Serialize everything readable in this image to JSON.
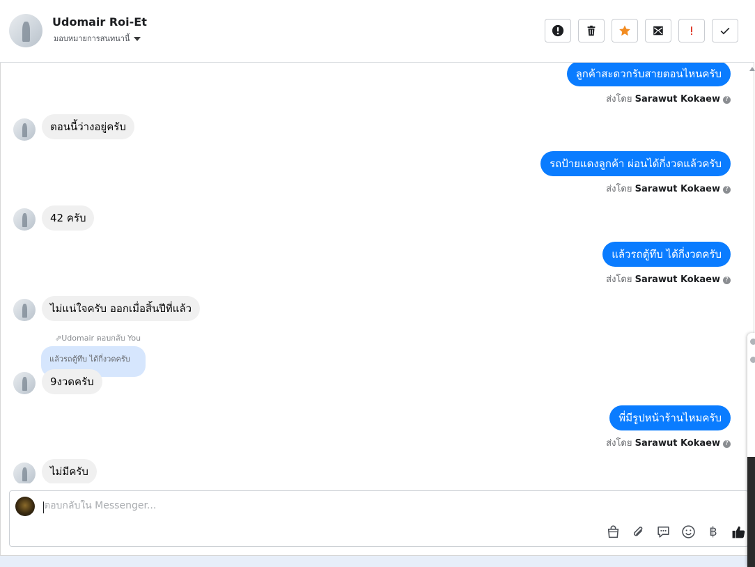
{
  "header": {
    "contact_name": "Udomair Roi-Et",
    "assignment_label": "มอบหมายการสนทนานี้",
    "actions": [
      {
        "name": "report-spam-icon",
        "color": "#1c1e21"
      },
      {
        "name": "trash-icon",
        "color": "#1c1e21"
      },
      {
        "name": "star-icon",
        "color": "#f28b20"
      },
      {
        "name": "mark-unread-icon",
        "color": "#1c1e21"
      },
      {
        "name": "exclamation-icon",
        "color": "#e03c2c"
      },
      {
        "name": "check-icon",
        "color": "#1c1e21"
      }
    ]
  },
  "messages": {
    "m1": {
      "text": "ลูกค้าสะดวกรับสายตอนไหนครับ",
      "sent_by_prefix": "ส่งโดย",
      "sender": "Sarawut Kokaew"
    },
    "m2": {
      "text": "ตอนนี้ว่างอยู่ครับ"
    },
    "m3": {
      "text": "รถป้ายแดงลูกค้า ผ่อนได้กี่งวดแล้วครับ",
      "sent_by_prefix": "ส่งโดย",
      "sender": "Sarawut Kokaew"
    },
    "m4": {
      "text": "42 ครับ"
    },
    "m5": {
      "text": "แล้วรถตู้ทึบ ได้กี่งวดครับ",
      "sent_by_prefix": "ส่งโดย",
      "sender": "Sarawut Kokaew"
    },
    "m6": {
      "text": "ไม่แน่ใจครับ ออกเมื่อสิ้นปีที่แล้ว"
    },
    "m7": {
      "reply_label": "Udomair ตอบกลับ You",
      "quoted": "แล้วรถตู้ทึบ ได้กี่งวดครับ",
      "text": "9งวดครับ"
    },
    "m8": {
      "text": "พี่มีรูปหน้าร้านไหมครับ",
      "sent_by_prefix": "ส่งโดย",
      "sender": "Sarawut Kokaew"
    },
    "m9": {
      "text": "ไม่มีครับ"
    }
  },
  "composer": {
    "placeholder": "ตอบกลับใน Messenger...",
    "tools": [
      "shopping-bag-icon",
      "paperclip-icon",
      "saved-reply-icon",
      "emoji-icon",
      "baht-icon",
      "thumbs-up-icon"
    ],
    "baht_symbol": "฿"
  },
  "colors": {
    "outgoing_bubble": "#0a7cff",
    "incoming_bubble": "#f0f0f0",
    "reply_quote": "#d6e6fd",
    "star": "#f28b20",
    "exclamation": "#e03c2c"
  }
}
